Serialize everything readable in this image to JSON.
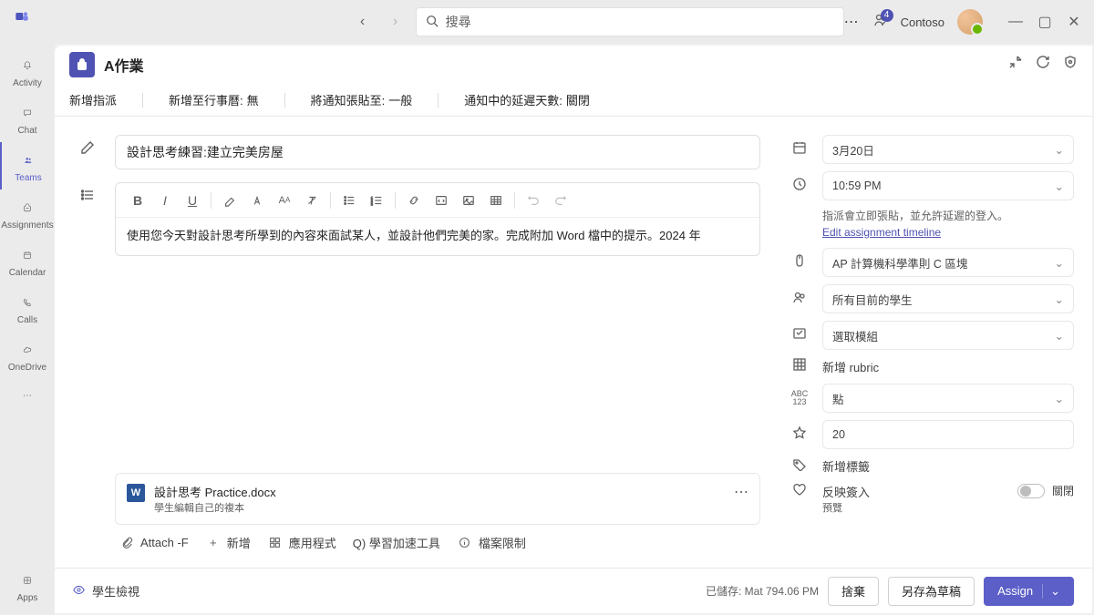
{
  "titlebar": {
    "search_placeholder": "搜尋",
    "org_name": "Contoso",
    "activity_count": "4"
  },
  "rail": {
    "items": [
      {
        "label": "Activity"
      },
      {
        "label": "Chat"
      },
      {
        "label": "Teams"
      },
      {
        "label": "Assignments"
      },
      {
        "label": "Calendar"
      },
      {
        "label": "Calls"
      },
      {
        "label": "OneDrive"
      }
    ],
    "apps_label": "Apps"
  },
  "app": {
    "title": "A作業"
  },
  "tabs": {
    "t1_label": "新增指派",
    "t2_label": "新增至行事曆:",
    "t2_value": "無",
    "t3_label": "將通知張貼至:",
    "t3_value": "一般",
    "t4_label": "通知中的延遲天數:",
    "t4_value": "關閉"
  },
  "assignment": {
    "title": "設計思考練習:建立完美房屋",
    "instructions": "使用您今天對設計思考所學到的內容來面試某人，並設計他們完美的家。完成附加 Word 檔中的提示。2024 年"
  },
  "attachment": {
    "filename": "設計思考 Practice.docx",
    "subtitle": "學生編輯自己的複本"
  },
  "attach_bar": {
    "attach": "Attach -F",
    "new": "新增",
    "apps": "應用程式",
    "learn": "Q) 學習加速工具",
    "limit": "檔案限制"
  },
  "side": {
    "date": "3月20日",
    "time": "10:59 PM",
    "timeline_note": "指派會立即張貼，並允許延遲的登入。",
    "timeline_link": "Edit assignment timeline",
    "class": "AP 計算機科學準則 C 區塊",
    "students": "所有目前的學生",
    "module": "選取模組",
    "rubric": "新增 rubric",
    "points_label": "點",
    "points_value": "20",
    "tag": "新增標籤",
    "reflect_label": "反映簽入",
    "reflect_preview": "預覽",
    "reflect_state": "關閉"
  },
  "footer": {
    "student_view": "學生檢視",
    "saved_label": "已儲存:",
    "saved_value": "Mat 794.06 PM",
    "discard": "捨棄",
    "save_draft": "另存為草稿",
    "assign": "Assign"
  }
}
